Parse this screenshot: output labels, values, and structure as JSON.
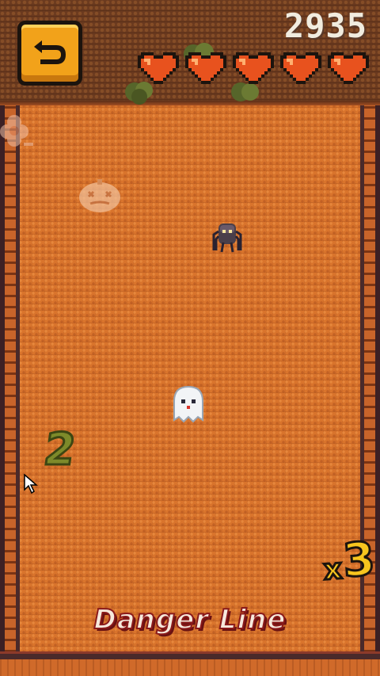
{
  "hud": {
    "score": "2935",
    "lives": 5,
    "multiplier_prefix": "x",
    "multiplier_value": "3"
  },
  "field": {
    "danger_line_label": "Danger Line",
    "number_pickup": "2"
  },
  "icons": {
    "back": "back-arrow-icon",
    "heart": "heart-icon"
  },
  "colors": {
    "floor": "#d9742c",
    "top_band": "#6b3a1f",
    "button": "#f2a21a",
    "heart": "#e8521e",
    "multiplier": "#f7c51e",
    "danger_text_outline": "#8a1a1a"
  }
}
